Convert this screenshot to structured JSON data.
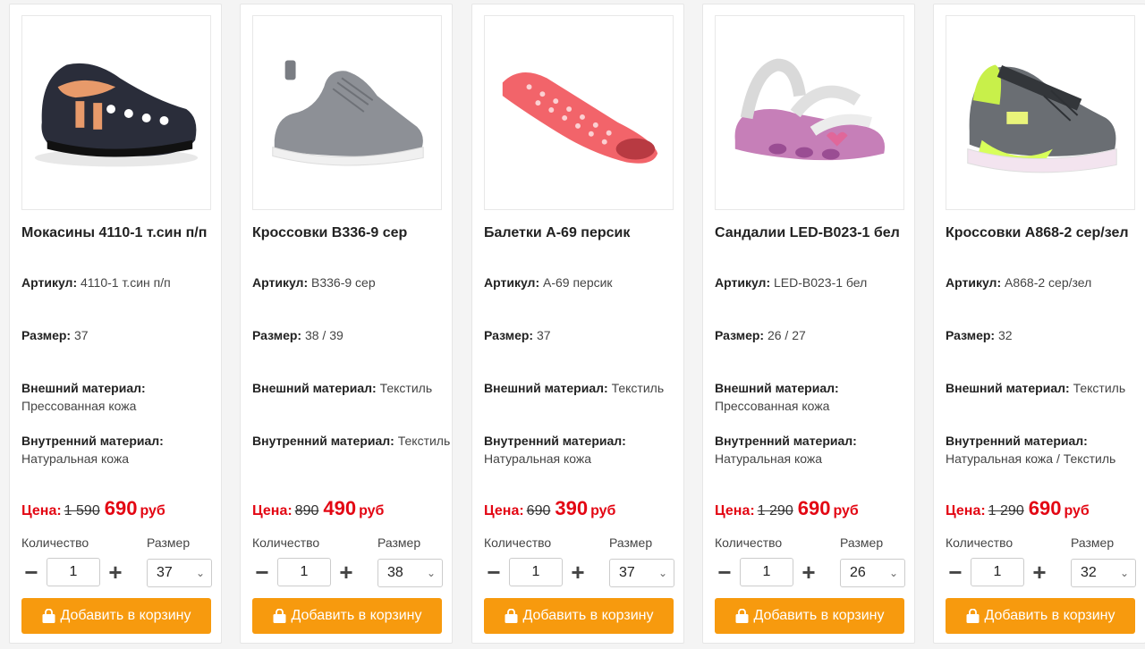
{
  "labels": {
    "article": "Артикул:",
    "size": "Размер:",
    "outer": "Внешний материал:",
    "inner": "Внутренний материал:",
    "price": "Цена:",
    "currency": "руб",
    "quantity": "Количество",
    "size_select": "Размер",
    "cart": "Добавить в корзину",
    "minus": "−",
    "plus": "+"
  },
  "icons": {
    "cart_button": "shopping-bag-icon",
    "select_arrow": "chevron-down-icon"
  },
  "colors": {
    "accent": "#f79a0e",
    "price": "#e30613"
  },
  "products": [
    {
      "title": "Мокасины 4110-1 т.син п/п",
      "article": "4110-1 т.син п/п",
      "size": "37",
      "outer": "Прессованная кожа",
      "inner": "Натуральная кожа",
      "old_price": "1 590",
      "price": "690",
      "qty": "1",
      "selected_size": "37"
    },
    {
      "title": "Кроссовки B336-9 сер",
      "article": "B336-9 сер",
      "size": "38 / 39",
      "outer": "Текстиль",
      "inner": "Текстиль",
      "old_price": "890",
      "price": "490",
      "qty": "1",
      "selected_size": "38"
    },
    {
      "title": "Балетки A-69 персик",
      "article": "A-69 персик",
      "size": "37",
      "outer": "Текстиль",
      "inner": "Натуральная кожа",
      "old_price": "690",
      "price": "390",
      "qty": "1",
      "selected_size": "37"
    },
    {
      "title": "Сандалии LED-B023-1 бел",
      "article": "LED-B023-1 бел",
      "size": "26 / 27",
      "outer": "Прессованная кожа",
      "inner": "Натуральная кожа",
      "old_price": "1 290",
      "price": "690",
      "qty": "1",
      "selected_size": "26"
    },
    {
      "title": "Кроссовки A868-2 сер/зел",
      "article": "A868-2 сер/зел",
      "size": "32",
      "outer": "Текстиль",
      "inner": "Натуральная кожа / Текстиль",
      "old_price": "1 290",
      "price": "690",
      "qty": "1",
      "selected_size": "32"
    }
  ]
}
